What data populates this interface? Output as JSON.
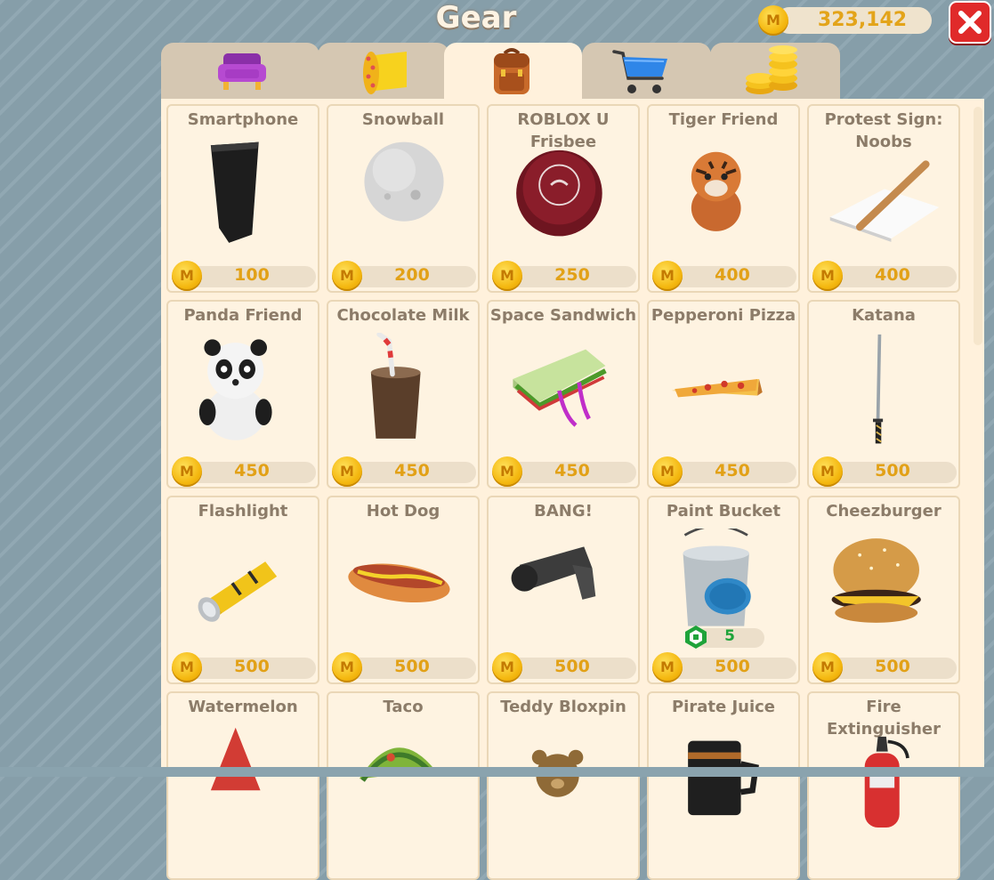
{
  "header": {
    "title": "Gear"
  },
  "currency": {
    "symbol": "M",
    "amount": "323,142"
  },
  "tabs": [
    {
      "icon": "sofa-icon"
    },
    {
      "icon": "wallpaper-roll-icon"
    },
    {
      "icon": "backpack-icon",
      "active": true
    },
    {
      "icon": "shopping-cart-icon"
    },
    {
      "icon": "coin-stack-icon"
    }
  ],
  "coin_symbol": "M",
  "items": [
    {
      "name": "Smartphone",
      "price": "100",
      "icon": "smartphone-icon"
    },
    {
      "name": "Snowball",
      "price": "200",
      "icon": "snowball-icon"
    },
    {
      "name": "ROBLOX U Frisbee",
      "price": "250",
      "icon": "frisbee-icon"
    },
    {
      "name": "Tiger Friend",
      "price": "400",
      "icon": "tiger-plush-icon"
    },
    {
      "name": "Protest Sign: Noobs",
      "price": "400",
      "icon": "protest-sign-icon"
    },
    {
      "name": "Panda Friend",
      "price": "450",
      "icon": "panda-plush-icon"
    },
    {
      "name": "Chocolate Milk",
      "price": "450",
      "icon": "chocolate-milk-icon"
    },
    {
      "name": "Space Sandwich",
      "price": "450",
      "icon": "sandwich-icon"
    },
    {
      "name": "Pepperoni Pizza",
      "price": "450",
      "icon": "pizza-slice-icon"
    },
    {
      "name": "Katana",
      "price": "500",
      "icon": "katana-icon"
    },
    {
      "name": "Flashlight",
      "price": "500",
      "icon": "flashlight-icon"
    },
    {
      "name": "Hot Dog",
      "price": "500",
      "icon": "hot-dog-icon"
    },
    {
      "name": "BANG!",
      "price": "500",
      "icon": "pistol-icon"
    },
    {
      "name": "Paint Bucket",
      "price": "500",
      "robux": "5",
      "icon": "paint-bucket-icon"
    },
    {
      "name": "Cheezburger",
      "price": "500",
      "icon": "burger-icon"
    },
    {
      "name": "Watermelon",
      "icon": "watermelon-icon"
    },
    {
      "name": "Taco",
      "icon": "taco-icon"
    },
    {
      "name": "Teddy Bloxpin",
      "icon": "teddy-bear-icon"
    },
    {
      "name": "Pirate Juice",
      "icon": "mug-icon"
    },
    {
      "name": "Fire Extinguisher",
      "icon": "fire-extinguisher-icon"
    }
  ],
  "colors": {
    "panel": "#fff1dc",
    "tab_inactive": "#d5c7b2",
    "price_text": "#e2a117",
    "close_button": "#e02a2a",
    "robux_text": "#1fa33a"
  }
}
